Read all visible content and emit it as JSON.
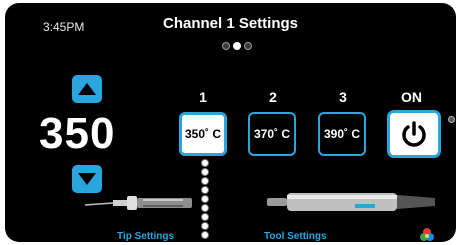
{
  "status": {
    "time": "3:45PM"
  },
  "header": {
    "title": "Channel 1 Settings"
  },
  "pager": {
    "count": 3,
    "active_index": 1
  },
  "temperature": {
    "current": "350"
  },
  "presets": [
    {
      "number": "1",
      "label": "350˚ C",
      "selected": true
    },
    {
      "number": "2",
      "label": "370˚ C",
      "selected": false
    },
    {
      "number": "3",
      "label": "390˚ C",
      "selected": false
    }
  ],
  "power": {
    "label": "ON",
    "icon": "power-icon"
  },
  "footer": {
    "tip_settings": "Tip Settings",
    "tool_settings": "Tool Settings",
    "theme_icon": "color-palette-icon"
  },
  "colors": {
    "accent": "#29a6dd",
    "background": "#000000",
    "selected_bg": "#ffffff"
  }
}
